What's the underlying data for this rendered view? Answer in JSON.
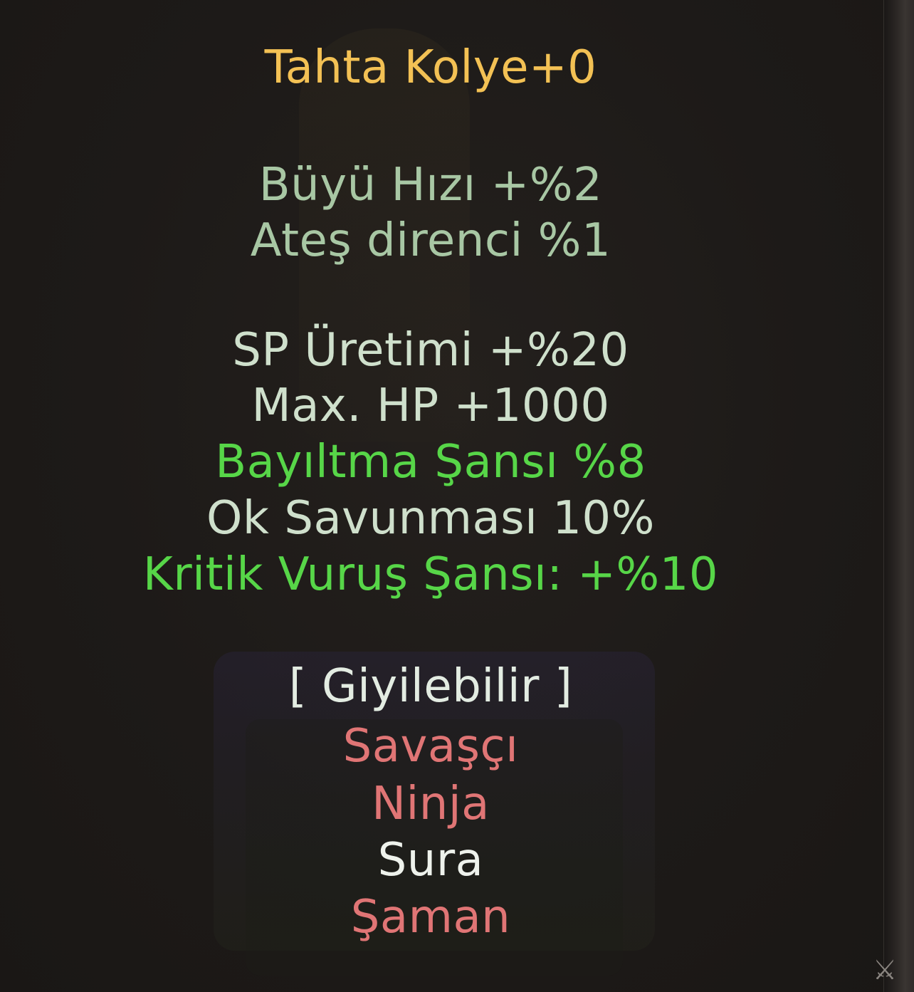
{
  "item": {
    "name": "Tahta Kolye+0",
    "base_bonuses": [
      "Büyü Hızı +%2",
      "Ateş direnci %1"
    ],
    "extra_bonuses": [
      "SP Üretimi +%20",
      "Max. HP +1000",
      "Bayıltma Şansı %8",
      "Ok Savunması 10%",
      "Kritik Vuruş Şansı: +%10"
    ],
    "wearable_label": "[ Giyilebilir ]",
    "classes": [
      "Savaşçı",
      "Ninja",
      "Sura",
      "Şaman"
    ]
  },
  "colors": {
    "title": "#f3c154",
    "base_bonus": "#a8c7a4",
    "extra_bonus": "#cfe0cc",
    "highlight_bonus": "#57d648",
    "class_not_allowed": "#e07575",
    "class_allowed": "#eef2ec"
  },
  "icons": {
    "corner": "sword-ornament-icon"
  }
}
